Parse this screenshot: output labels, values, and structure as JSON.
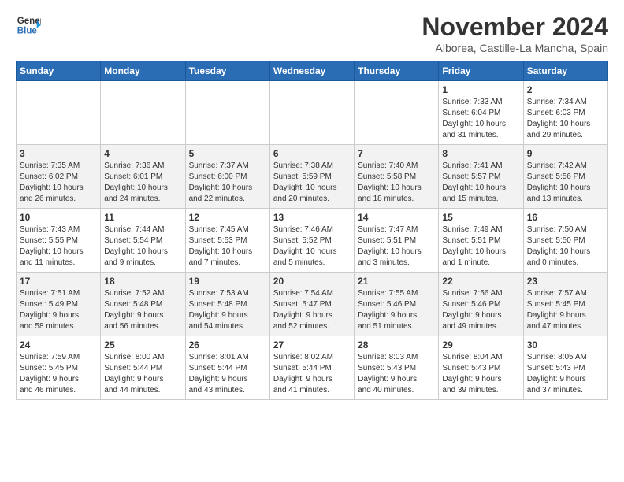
{
  "logo": {
    "line1": "General",
    "line2": "Blue"
  },
  "title": "November 2024",
  "subtitle": "Alborea, Castille-La Mancha, Spain",
  "days_of_week": [
    "Sunday",
    "Monday",
    "Tuesday",
    "Wednesday",
    "Thursday",
    "Friday",
    "Saturday"
  ],
  "weeks": [
    [
      {
        "day": "",
        "content": ""
      },
      {
        "day": "",
        "content": ""
      },
      {
        "day": "",
        "content": ""
      },
      {
        "day": "",
        "content": ""
      },
      {
        "day": "",
        "content": ""
      },
      {
        "day": "1",
        "content": "Sunrise: 7:33 AM\nSunset: 6:04 PM\nDaylight: 10 hours\nand 31 minutes."
      },
      {
        "day": "2",
        "content": "Sunrise: 7:34 AM\nSunset: 6:03 PM\nDaylight: 10 hours\nand 29 minutes."
      }
    ],
    [
      {
        "day": "3",
        "content": "Sunrise: 7:35 AM\nSunset: 6:02 PM\nDaylight: 10 hours\nand 26 minutes."
      },
      {
        "day": "4",
        "content": "Sunrise: 7:36 AM\nSunset: 6:01 PM\nDaylight: 10 hours\nand 24 minutes."
      },
      {
        "day": "5",
        "content": "Sunrise: 7:37 AM\nSunset: 6:00 PM\nDaylight: 10 hours\nand 22 minutes."
      },
      {
        "day": "6",
        "content": "Sunrise: 7:38 AM\nSunset: 5:59 PM\nDaylight: 10 hours\nand 20 minutes."
      },
      {
        "day": "7",
        "content": "Sunrise: 7:40 AM\nSunset: 5:58 PM\nDaylight: 10 hours\nand 18 minutes."
      },
      {
        "day": "8",
        "content": "Sunrise: 7:41 AM\nSunset: 5:57 PM\nDaylight: 10 hours\nand 15 minutes."
      },
      {
        "day": "9",
        "content": "Sunrise: 7:42 AM\nSunset: 5:56 PM\nDaylight: 10 hours\nand 13 minutes."
      }
    ],
    [
      {
        "day": "10",
        "content": "Sunrise: 7:43 AM\nSunset: 5:55 PM\nDaylight: 10 hours\nand 11 minutes."
      },
      {
        "day": "11",
        "content": "Sunrise: 7:44 AM\nSunset: 5:54 PM\nDaylight: 10 hours\nand 9 minutes."
      },
      {
        "day": "12",
        "content": "Sunrise: 7:45 AM\nSunset: 5:53 PM\nDaylight: 10 hours\nand 7 minutes."
      },
      {
        "day": "13",
        "content": "Sunrise: 7:46 AM\nSunset: 5:52 PM\nDaylight: 10 hours\nand 5 minutes."
      },
      {
        "day": "14",
        "content": "Sunrise: 7:47 AM\nSunset: 5:51 PM\nDaylight: 10 hours\nand 3 minutes."
      },
      {
        "day": "15",
        "content": "Sunrise: 7:49 AM\nSunset: 5:51 PM\nDaylight: 10 hours\nand 1 minute."
      },
      {
        "day": "16",
        "content": "Sunrise: 7:50 AM\nSunset: 5:50 PM\nDaylight: 10 hours\nand 0 minutes."
      }
    ],
    [
      {
        "day": "17",
        "content": "Sunrise: 7:51 AM\nSunset: 5:49 PM\nDaylight: 9 hours\nand 58 minutes."
      },
      {
        "day": "18",
        "content": "Sunrise: 7:52 AM\nSunset: 5:48 PM\nDaylight: 9 hours\nand 56 minutes."
      },
      {
        "day": "19",
        "content": "Sunrise: 7:53 AM\nSunset: 5:48 PM\nDaylight: 9 hours\nand 54 minutes."
      },
      {
        "day": "20",
        "content": "Sunrise: 7:54 AM\nSunset: 5:47 PM\nDaylight: 9 hours\nand 52 minutes."
      },
      {
        "day": "21",
        "content": "Sunrise: 7:55 AM\nSunset: 5:46 PM\nDaylight: 9 hours\nand 51 minutes."
      },
      {
        "day": "22",
        "content": "Sunrise: 7:56 AM\nSunset: 5:46 PM\nDaylight: 9 hours\nand 49 minutes."
      },
      {
        "day": "23",
        "content": "Sunrise: 7:57 AM\nSunset: 5:45 PM\nDaylight: 9 hours\nand 47 minutes."
      }
    ],
    [
      {
        "day": "24",
        "content": "Sunrise: 7:59 AM\nSunset: 5:45 PM\nDaylight: 9 hours\nand 46 minutes."
      },
      {
        "day": "25",
        "content": "Sunrise: 8:00 AM\nSunset: 5:44 PM\nDaylight: 9 hours\nand 44 minutes."
      },
      {
        "day": "26",
        "content": "Sunrise: 8:01 AM\nSunset: 5:44 PM\nDaylight: 9 hours\nand 43 minutes."
      },
      {
        "day": "27",
        "content": "Sunrise: 8:02 AM\nSunset: 5:44 PM\nDaylight: 9 hours\nand 41 minutes."
      },
      {
        "day": "28",
        "content": "Sunrise: 8:03 AM\nSunset: 5:43 PM\nDaylight: 9 hours\nand 40 minutes."
      },
      {
        "day": "29",
        "content": "Sunrise: 8:04 AM\nSunset: 5:43 PM\nDaylight: 9 hours\nand 39 minutes."
      },
      {
        "day": "30",
        "content": "Sunrise: 8:05 AM\nSunset: 5:43 PM\nDaylight: 9 hours\nand 37 minutes."
      }
    ]
  ]
}
